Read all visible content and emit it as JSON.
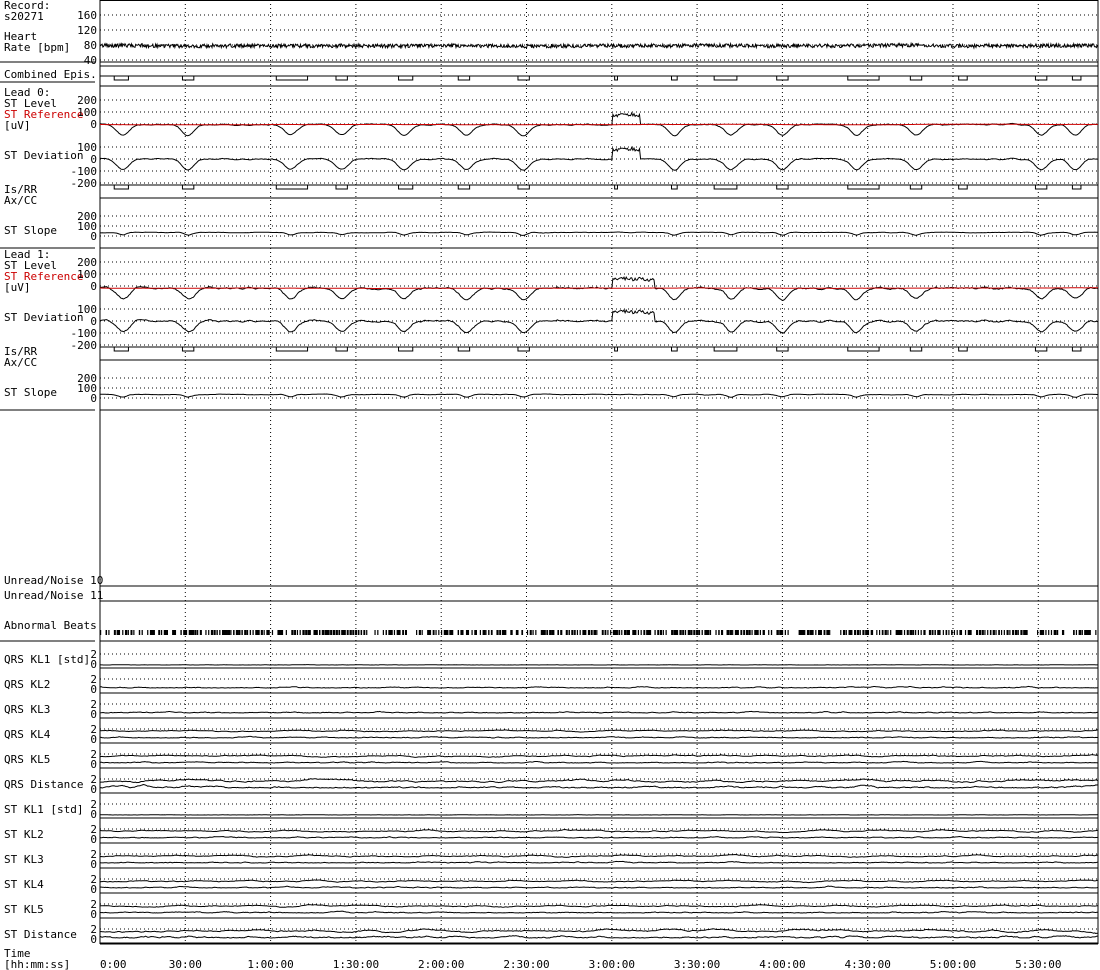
{
  "chart_data": {
    "type": "line",
    "record": "s20271",
    "record_label": "Record:",
    "time_axis": {
      "label_line1": "Time",
      "label_line2": "[hh:mm:ss]",
      "range_seconds": [
        0,
        21060
      ],
      "tick_labels": [
        "0:00",
        "30:00",
        "1:00:00",
        "1:30:00",
        "2:00:00",
        "2:30:00",
        "3:00:00",
        "3:30:00",
        "4:00:00",
        "4:30:00",
        "5:00:00",
        "5:30:00"
      ]
    },
    "colors": {
      "trace": "#000000",
      "reference": "#cc0000",
      "grid": "#000000"
    },
    "heart_rate": {
      "label_line1": "Heart",
      "label_line2": "Rate [bpm]",
      "ticks": [
        "160",
        "120",
        "80",
        "40"
      ],
      "ylim": [
        40,
        160
      ],
      "baseline_bpm": 78
    },
    "combined_episodes": {
      "label": "Combined Epis.",
      "intervals_hhmmss": [
        [
          "0:05:00",
          "0:10:00"
        ],
        [
          "0:29:00",
          "0:33:00"
        ],
        [
          "1:02:00",
          "1:13:00"
        ],
        [
          "1:23:00",
          "1:27:00"
        ],
        [
          "1:45:00",
          "1:50:00"
        ],
        [
          "2:06:00",
          "2:10:00"
        ],
        [
          "2:27:00",
          "2:31:00"
        ],
        [
          "3:01:00",
          "3:02:00"
        ],
        [
          "3:21:00",
          "3:23:00"
        ],
        [
          "3:36:00",
          "3:44:00"
        ],
        [
          "3:58:00",
          "4:02:00"
        ],
        [
          "4:23:00",
          "4:34:00"
        ],
        [
          "4:45:00",
          "4:49:00"
        ],
        [
          "5:02:00",
          "5:05:00"
        ],
        [
          "5:29:00",
          "5:33:00"
        ],
        [
          "5:42:00",
          "5:45:00"
        ]
      ]
    },
    "leads": [
      {
        "title": "Lead 0:",
        "st_level_label": "ST Level",
        "st_reference_label": "ST Reference",
        "unit_label": "[uV]",
        "level_ticks": [
          "200",
          "100",
          "0"
        ],
        "st_deviation_label": "ST Deviation",
        "deviation_ticks": [
          "100",
          "0",
          "-100",
          "-200"
        ],
        "isrr_label": "Is/RR",
        "axcc_label": "Ax/CC",
        "st_slope_label": "ST Slope",
        "slope_ticks": [
          "200",
          "100",
          "0"
        ],
        "dips_hhmmss": [
          "0:08:00",
          "0:31:00",
          "1:07:00",
          "1:25:00",
          "1:47:00",
          "2:09:00",
          "2:29:00",
          "3:22:00",
          "3:42:00",
          "4:00:00",
          "4:26:00",
          "4:47:00",
          "5:31:00",
          "5:43:00"
        ],
        "elevation_interval_hhmmss": [
          "3:00:00",
          "3:10:00"
        ]
      },
      {
        "title": "Lead 1:",
        "st_level_label": "ST Level",
        "st_reference_label": "ST Reference",
        "unit_label": "[uV]",
        "level_ticks": [
          "200",
          "100",
          "0"
        ],
        "st_deviation_label": "ST Deviation",
        "deviation_ticks": [
          "100",
          "0",
          "-100",
          "-200"
        ],
        "isrr_label": "Is/RR",
        "axcc_label": "Ax/CC",
        "st_slope_label": "ST Slope",
        "slope_ticks": [
          "200",
          "100",
          "0"
        ],
        "dips_hhmmss": [
          "0:08:00",
          "0:31:00",
          "1:07:00",
          "1:25:00",
          "1:47:00",
          "2:09:00",
          "2:29:00",
          "3:22:00",
          "3:42:00",
          "4:00:00",
          "4:26:00",
          "4:47:00",
          "5:31:00",
          "5:43:00"
        ],
        "elevation_interval_hhmmss": [
          "3:00:00",
          "3:15:00"
        ]
      }
    ],
    "unread_noise": [
      "Unread/Noise 10",
      "Unread/Noise 11"
    ],
    "abnormal_beats_label": "Abnormal Beats",
    "kl_ticks": [
      "2",
      "0"
    ],
    "qrs_rows": [
      "QRS KL1 [std]",
      "QRS KL2",
      "QRS KL3",
      "QRS KL4",
      "QRS KL5",
      "QRS Distance"
    ],
    "st_rows": [
      "ST KL1 [std]",
      "ST KL2",
      "ST KL3",
      "ST KL4",
      "ST KL5",
      "ST Distance"
    ]
  }
}
